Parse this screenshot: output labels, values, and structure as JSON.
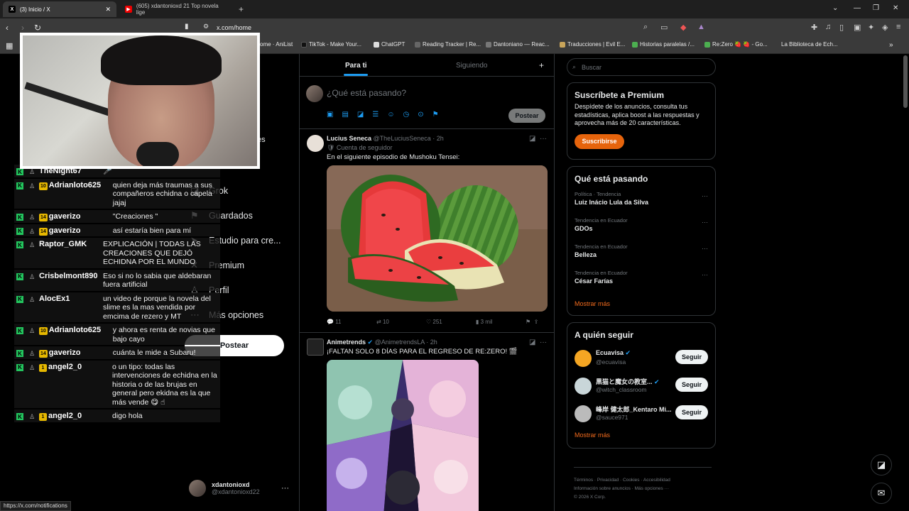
{
  "browser": {
    "tabs": [
      {
        "label": "(3) Inicio / X",
        "favicon": "X"
      },
      {
        "label": "(605) xdantonioxd 21 Top novela lige",
        "favicon": "▶"
      }
    ],
    "url": "x.com/home",
    "bookmarks": [
      "ome · AniList",
      "TikTok - Make Your...",
      "ChatGPT",
      "Reading Tracker | Re...",
      "Dantoniano — Reac...",
      "Traducciones | Evil E...",
      "Historias paralelas /...",
      "Re:Zero 🍓 🍓 - Go...",
      "La Biblioteca de Ech..."
    ],
    "status_url": "https://x.com/notifications"
  },
  "chat": [
    {
      "user": "TheNight67",
      "badge": "",
      "msg": "🎤"
    },
    {
      "user": "Adrianloto625",
      "badge": "10",
      "msg": "quien deja más traumas a sus compañeros echidna o capela jajaj"
    },
    {
      "user": "gaverizo",
      "badge": "14",
      "msg": "\"Creaciones \""
    },
    {
      "user": "gaverizo",
      "badge": "14",
      "msg": "así estaría bien para mí"
    },
    {
      "user": "Raptor_GMK",
      "badge": "",
      "msg": "EXPLICACIÓN | TODAS LAS CREACIONES QUE DEJÓ ECHIDNA POR EL MUNDO"
    },
    {
      "user": "Crisbelmont890",
      "badge": "",
      "msg": "Eso si no lo sabia que aldebaran fuera artificial"
    },
    {
      "user": "AlocEx1",
      "badge": "",
      "msg": "un video de porque la novela del slime es la mas vendida por emcima de rezero y MT"
    },
    {
      "user": "Adrianloto625",
      "badge": "10",
      "msg": "y ahora es renta de novias que bajo cayo"
    },
    {
      "user": "gaverizo",
      "badge": "14",
      "msg": "cuánta le mide a Subaru!"
    },
    {
      "user": "angel2_0",
      "badge": "1",
      "msg": "o un tipo: todas las intervenciones de echidna en la historia o de las brujas en general pero ekidna es la que más vende 😋 ☝"
    },
    {
      "user": "angel2_0",
      "badge": "1",
      "msg": "digo hola"
    }
  ],
  "nav": {
    "items": [
      {
        "label": "Grok",
        "icon": "grok-icon"
      },
      {
        "label": "Guardados",
        "icon": "bookmark-icon"
      },
      {
        "label": "Estudio para cre...",
        "icon": "studio-icon"
      },
      {
        "label": "Premium",
        "icon": "premium-icon"
      },
      {
        "label": "Perfil",
        "icon": "person-icon"
      },
      {
        "label": "Más opciones",
        "icon": "more-circle-icon"
      }
    ],
    "hidden_label": "es",
    "post_label": "Postear",
    "profile_name": "xdantonioxd",
    "profile_handle": "@xdantonioxd22"
  },
  "feed": {
    "tab_foryou": "Para ti",
    "tab_following": "Siguiendo",
    "composer_placeholder": "¿Qué está pasando?",
    "composer_post": "Postear",
    "tweets": [
      {
        "name": "Lucius Seneca",
        "handle": "@TheLuciusSeneca · 2h",
        "sub": "🛡 Cuenta de seguidor",
        "text": "En el siguiente episodio de Mushoku Tensei:",
        "replies": "11",
        "retweets": "10",
        "likes": "251",
        "views": "3 mil"
      },
      {
        "name": "Animetrends",
        "handle": "@AnimetrendsLA · 2h",
        "text": "¡FALTAN SOLO 8 DÍAS PARA EL REGRESO DE RE:ZERO! 🎬"
      }
    ]
  },
  "sidebar": {
    "search_placeholder": "Buscar",
    "premium": {
      "title": "Suscríbete a Premium",
      "desc": "Despídete de los anuncios, consulta tus estadísticas, aplica boost a las respuestas y aprovecha más de 20 características.",
      "button": "Suscribirse"
    },
    "trends_title": "Qué está pasando",
    "trends": [
      {
        "cat": "Política · Tendencia",
        "title": "Luiz Inácio Lula da Silva"
      },
      {
        "cat": "Tendencia en Ecuador",
        "title": "GDOs"
      },
      {
        "cat": "Tendencia en Ecuador",
        "title": "Belleza"
      },
      {
        "cat": "Tendencia en Ecuador",
        "title": "César Farías"
      }
    ],
    "show_more": "Mostrar más",
    "follow_title": "A quién seguir",
    "follow": [
      {
        "name": "Ecuavisa",
        "handle": "@ecuavisa"
      },
      {
        "name": "黒猫と魔女の教室...",
        "handle": "@witch_classroom"
      },
      {
        "name": "峰岸 健太郎_Kentaro Mi...",
        "handle": "@sauce971"
      }
    ],
    "follow_button": "Seguir",
    "footer": [
      "Términos",
      "Privacidad",
      "Cookies",
      "Accesibilidad",
      "Información sobre anuncios",
      "Más opciones ···",
      "© 2026 X Corp."
    ]
  },
  "colors": {
    "accent": "#1d9bf0",
    "premium_orange": "#e6640c",
    "link_orange": "#f26b1d",
    "chat_green": "#23c55e"
  }
}
